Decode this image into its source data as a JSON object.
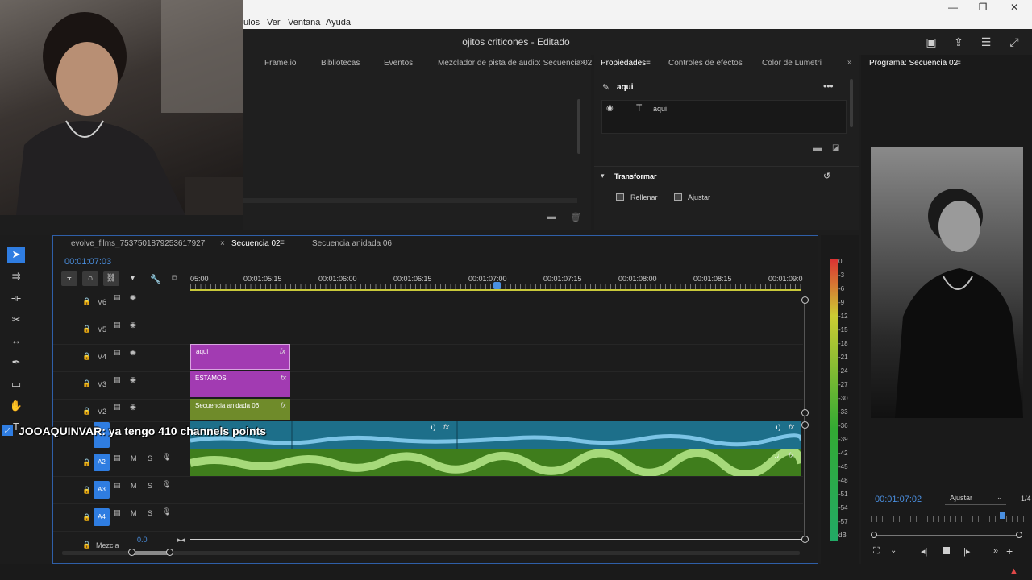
{
  "menubar": {
    "items": [
      "ulos",
      "Ver",
      "Ventana",
      "Ayuda"
    ],
    "window_buttons": [
      "—",
      "❐",
      "✕"
    ]
  },
  "titlebar": {
    "title": "ojitos criticones - Editado"
  },
  "source_panel": {
    "tabs": [
      "Frame.io",
      "Bibliotecas",
      "Eventos",
      "Mezclador de pista de audio: Secuencia 02"
    ]
  },
  "properties_panel": {
    "tabs": [
      "Propiedades",
      "Controles de efectos",
      "Color de Lumetri"
    ],
    "layer_name": "aqui",
    "text_layer": "aqui",
    "section": "Transformar",
    "fill_label": "Rellenar",
    "fit_label": "Ajustar"
  },
  "program_monitor": {
    "title": "Programa: Secuencia 02",
    "timecode": "00:01:07:02",
    "fit": "Ajustar",
    "quality": "1/4"
  },
  "timeline": {
    "tabs": [
      "evolve_films_7537501879253617927",
      "Secuencia 02",
      "Secuencia anidada 06"
    ],
    "timecode": "00:01:07:03",
    "ruler": [
      "05:00",
      "00:01:05:15",
      "00:01:06:00",
      "00:01:06:15",
      "00:01:07:00",
      "00:01:07:15",
      "00:01:08:00",
      "00:01:08:15",
      "00:01:09:0"
    ],
    "video_tracks": [
      "V6",
      "V5",
      "V4",
      "V3",
      "V2"
    ],
    "audio_tracks": [
      "A2",
      "A3",
      "A4"
    ],
    "mix_label": "Mezcla",
    "mix_value": "0.0",
    "clips": {
      "v4": "aqui",
      "v3": "ESTAMOS",
      "v2": "Secuencia anidada 06"
    },
    "track_buttons": {
      "m": "M",
      "s": "S"
    },
    "fx": "fx"
  },
  "chat_overlay": {
    "user": "JOOAQUINVAR",
    "message": ": ya tengo 410 channels points"
  },
  "vu_meter": {
    "labels": [
      "0",
      "-3",
      "-6",
      "-9",
      "-12",
      "-15",
      "-18",
      "-21",
      "-24",
      "-27",
      "-30",
      "-33",
      "-36",
      "-39",
      "-42",
      "-45",
      "-48",
      "-51",
      "-54",
      "-57",
      "dB"
    ]
  },
  "colors": {
    "accent_blue": "#2f7de1",
    "clip_purple": "#a23bb2",
    "clip_green": "#6f8b2a",
    "audio_teal": "#1d6f8a",
    "audio_green": "#3f7d1c",
    "playhead": "#4a8fe0"
  }
}
